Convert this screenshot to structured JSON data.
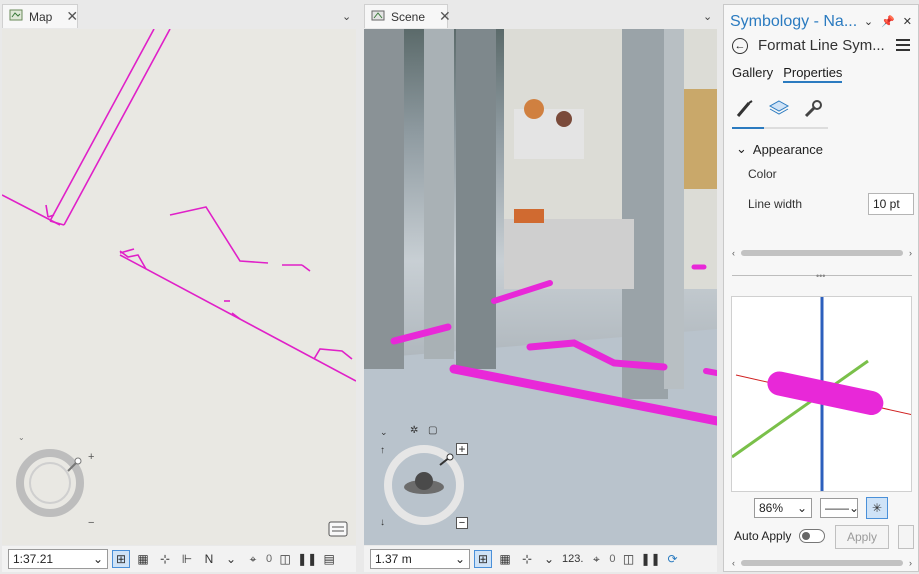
{
  "map_tab": {
    "title": "Map",
    "icon": "map-icon"
  },
  "scene_tab": {
    "title": "Scene",
    "icon": "scene-icon"
  },
  "map_status": {
    "scale": "1:37.21",
    "counter": "0"
  },
  "scene_status": {
    "distance": "1.37 m",
    "readout": "123.",
    "counter": "0"
  },
  "panel": {
    "title": "Symbology - Na...",
    "subtitle": "Format Line Sym...",
    "tabs": [
      "Gallery",
      "Properties"
    ],
    "active_tab": "Properties",
    "section": "Appearance",
    "color_label": "Color",
    "line_width_label": "Line width",
    "line_width_value": "10 pt",
    "zoom": "86%",
    "auto_apply_label": "Auto Apply",
    "apply_label": "Apply"
  },
  "colors": {
    "accent": "#2b7bc0",
    "line_magenta": "#e020c8",
    "pipe_magenta": "#e828d8"
  }
}
